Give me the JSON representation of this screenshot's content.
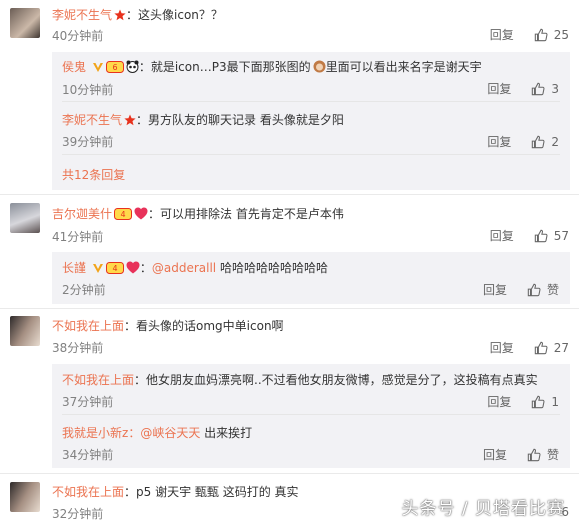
{
  "comments": [
    {
      "user": "李妮不生气",
      "text": "：这头像icon？？",
      "time": "40分钟前",
      "reply_label": "回复",
      "likes": "25",
      "replies": [
        {
          "user": "侯鬼",
          "text": "：就是icon…P3最下面那张图的",
          "text2": "里面可以看出来名字是谢天宇",
          "time": "10分钟前",
          "reply_label": "回复",
          "likes": "3"
        },
        {
          "user": "李妮不生气",
          "text": "：男方队友的聊天记录  看头像就是夕阳",
          "time": "39分钟前",
          "reply_label": "回复",
          "likes": "2"
        }
      ],
      "more": "共12条回复"
    },
    {
      "user": "吉尔迦美什",
      "text": "：可以用排除法 首先肯定不是卢本伟",
      "time": "41分钟前",
      "reply_label": "回复",
      "likes": "57",
      "replies": [
        {
          "user": "长謹",
          "mention": "@adderalll",
          "text": " 哈哈哈哈哈哈哈哈哈",
          "time": "2分钟前",
          "reply_label": "回复",
          "likes": "赞"
        }
      ]
    },
    {
      "user": "不如我在上面",
      "text": "：看头像的话omg中单icon啊",
      "time": "38分钟前",
      "reply_label": "回复",
      "likes": "27",
      "replies": [
        {
          "user": "不如我在上面",
          "text": "：他女朋友血妈漂亮啊..不过看他女朋友微博，感觉是分了，这投稿有点真实",
          "time": "37分钟前",
          "reply_label": "回复",
          "likes": "1"
        },
        {
          "user": "我就是小新z",
          "mention": "：@峡谷天天",
          "text": " 出来挨打",
          "time": "34分钟前",
          "reply_label": "回复",
          "likes": "赞"
        }
      ]
    },
    {
      "user": "不如我在上面",
      "text": "：p5 谢天宇 甄甄 这码打的 真实",
      "time": "32分钟前",
      "reply_label": "",
      "likes": "6"
    }
  ],
  "watermark": "头条号 / 贝塔看比赛",
  "colors": {
    "name": "#eb7350",
    "gray": "#808080",
    "sub_bg": "#f2f2f5"
  }
}
